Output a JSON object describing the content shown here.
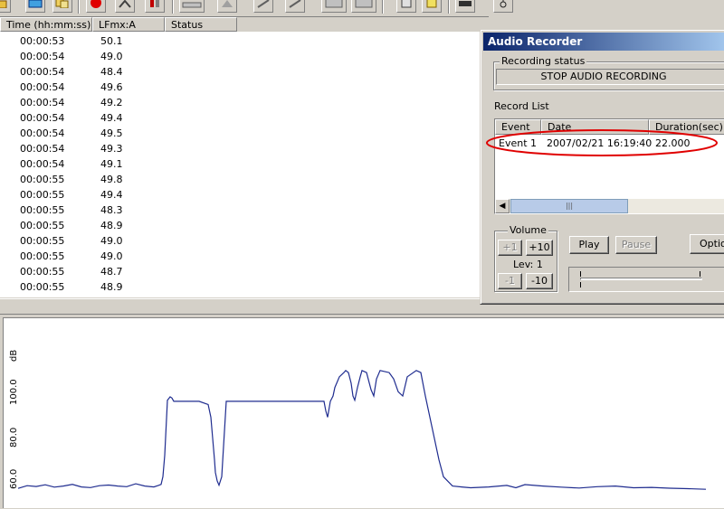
{
  "toolbar": {
    "icons": [
      "folder-open-icon",
      "calendar-icon",
      "copy-icon",
      "record-icon",
      "cut-icon",
      "marker-icon",
      "scale-icon",
      "bell-icon",
      "pen-icon",
      "pen2-icon",
      "document-icon",
      "document2-icon",
      "calc-icon",
      "note-icon",
      "printer-icon",
      "hand-icon"
    ]
  },
  "data_list": {
    "columns": [
      "Time (hh:mm:ss)",
      "LFmx:A",
      "Status"
    ],
    "rows": [
      {
        "time": "00:00:53",
        "value": "50.1"
      },
      {
        "time": "00:00:54",
        "value": "49.0"
      },
      {
        "time": "00:00:54",
        "value": "48.4"
      },
      {
        "time": "00:00:54",
        "value": "49.6"
      },
      {
        "time": "00:00:54",
        "value": "49.2"
      },
      {
        "time": "00:00:54",
        "value": "49.4"
      },
      {
        "time": "00:00:54",
        "value": "49.5"
      },
      {
        "time": "00:00:54",
        "value": "49.3"
      },
      {
        "time": "00:00:54",
        "value": "49.1"
      },
      {
        "time": "00:00:55",
        "value": "49.8"
      },
      {
        "time": "00:00:55",
        "value": "49.4"
      },
      {
        "time": "00:00:55",
        "value": "48.3"
      },
      {
        "time": "00:00:55",
        "value": "48.9"
      },
      {
        "time": "00:00:55",
        "value": "49.0"
      },
      {
        "time": "00:00:55",
        "value": "49.0"
      },
      {
        "time": "00:00:55",
        "value": "48.7"
      },
      {
        "time": "00:00:55",
        "value": "48.9"
      }
    ]
  },
  "chart": {
    "y_unit": "dB",
    "tick_labels": [
      "100.0",
      "80.0",
      "60.0"
    ],
    "line_color": "#1f2c8f"
  },
  "chart_data": {
    "type": "line",
    "title": "",
    "xlabel": "",
    "ylabel": "dB",
    "ylim": [
      53,
      123
    ],
    "yticks": [
      100.0,
      80.0,
      60.0
    ],
    "grid": false,
    "series": [
      {
        "x": [
          0,
          10,
          20,
          30,
          40,
          50,
          60,
          70,
          80,
          90,
          100,
          110,
          120,
          130,
          140,
          150,
          155,
          158,
          160,
          162,
          165,
          168,
          170,
          172,
          175,
          200,
          210,
          213,
          215,
          217,
          218,
          220,
          222,
          225,
          230,
          250,
          260,
          300,
          338,
          340,
          342,
          345,
          348,
          350,
          355,
          360,
          362,
          365,
          368,
          370,
          372,
          375,
          378,
          380,
          385,
          390,
          393,
          396,
          400,
          410,
          415,
          420,
          425,
          430,
          440,
          445,
          450,
          455,
          460,
          465,
          470,
          480,
          490,
          500,
          520,
          540,
          550,
          560,
          580,
          600,
          620,
          640,
          660,
          680,
          700,
          720,
          740,
          760
        ],
        "y": [
          56.5,
          57.8,
          57.4,
          58.2,
          57.1,
          57.6,
          58.4,
          57.2,
          56.9,
          57.8,
          58.1,
          57.6,
          57.3,
          58.7,
          57.6,
          57.2,
          57.9,
          58.4,
          62,
          72,
          98,
          99.6,
          99,
          97.5,
          97.5,
          97.5,
          96,
          90,
          80,
          70,
          64,
          60,
          58,
          62,
          97.5,
          97.5,
          97.5,
          97.5,
          97.5,
          93,
          90,
          97.5,
          100,
          104,
          109,
          111,
          112,
          111,
          106,
          100,
          98,
          104,
          109,
          112,
          111,
          103,
          100,
          108,
          112,
          111,
          108,
          102,
          100,
          109,
          112,
          111,
          100,
          90,
          80,
          70,
          62,
          57.6,
          57.2,
          56.8,
          57.2,
          57.9,
          56.8,
          58.3,
          57.6,
          57.1,
          56.7,
          57.3,
          57.6,
          56.8,
          57.0,
          56.6,
          56.4,
          56.1
        ]
      }
    ]
  },
  "recorder": {
    "title": "Audio Recorder",
    "status_group_label": "Recording status",
    "status_text": "STOP AUDIO RECORDING",
    "record_list_label": "Record List",
    "columns": [
      "Event",
      "Date",
      "Duration(sec)"
    ],
    "records": [
      {
        "event": "Event 1",
        "date": "2007/02/21 16:19:40",
        "duration": "22.000"
      }
    ],
    "highlight_color": "#e00000",
    "volume": {
      "label": "Volume",
      "plus1": "+1",
      "plus10": "+10",
      "level_text": "Lev: 1",
      "minus1": "-1",
      "minus10": "-10"
    },
    "play_label": "Play",
    "pause_label": "Pause",
    "options_label": "Option"
  }
}
